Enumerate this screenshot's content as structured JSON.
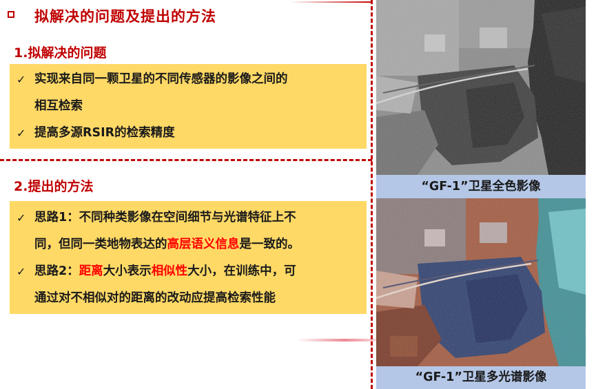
{
  "header": {
    "title": "拟解决的问题及提出的方法"
  },
  "section1": {
    "title": "1.拟解决的问题",
    "items": [
      {
        "check": "✓",
        "line1": "实现来自同一颗卫星的不同传感器的影像之间的",
        "line2": "相互检索"
      },
      {
        "check": "✓",
        "line1": "提高多源RSIR的检索精度"
      }
    ]
  },
  "section2": {
    "title": "2.提出的方法",
    "items": [
      {
        "check": "✓",
        "line1": "思路1：不同种类影像在空间细节与光谱特征上不",
        "line2_a": "同，但同一类地物表达的",
        "line2_highlight": "高层语义信息",
        "line2_b": "是一致的。"
      },
      {
        "check": "✓",
        "line1_a": "思路2：",
        "line1_hl1": "距离",
        "line1_b": "大小表示",
        "line1_hl2": "相似性",
        "line1_c": "大小，在训练中，可",
        "line2": "通过对不相似对的距离的改动应提高检索性能"
      }
    ]
  },
  "images": {
    "pan_caption": "“GF-1”卫星全色影像",
    "ms_caption": "“GF-1”卫星多光谱影像"
  },
  "colors": {
    "accent": "#c00000",
    "highlight_box": "#ffd966",
    "caption_bg": "#b4c7e7",
    "emphasis": "#ff0000"
  }
}
